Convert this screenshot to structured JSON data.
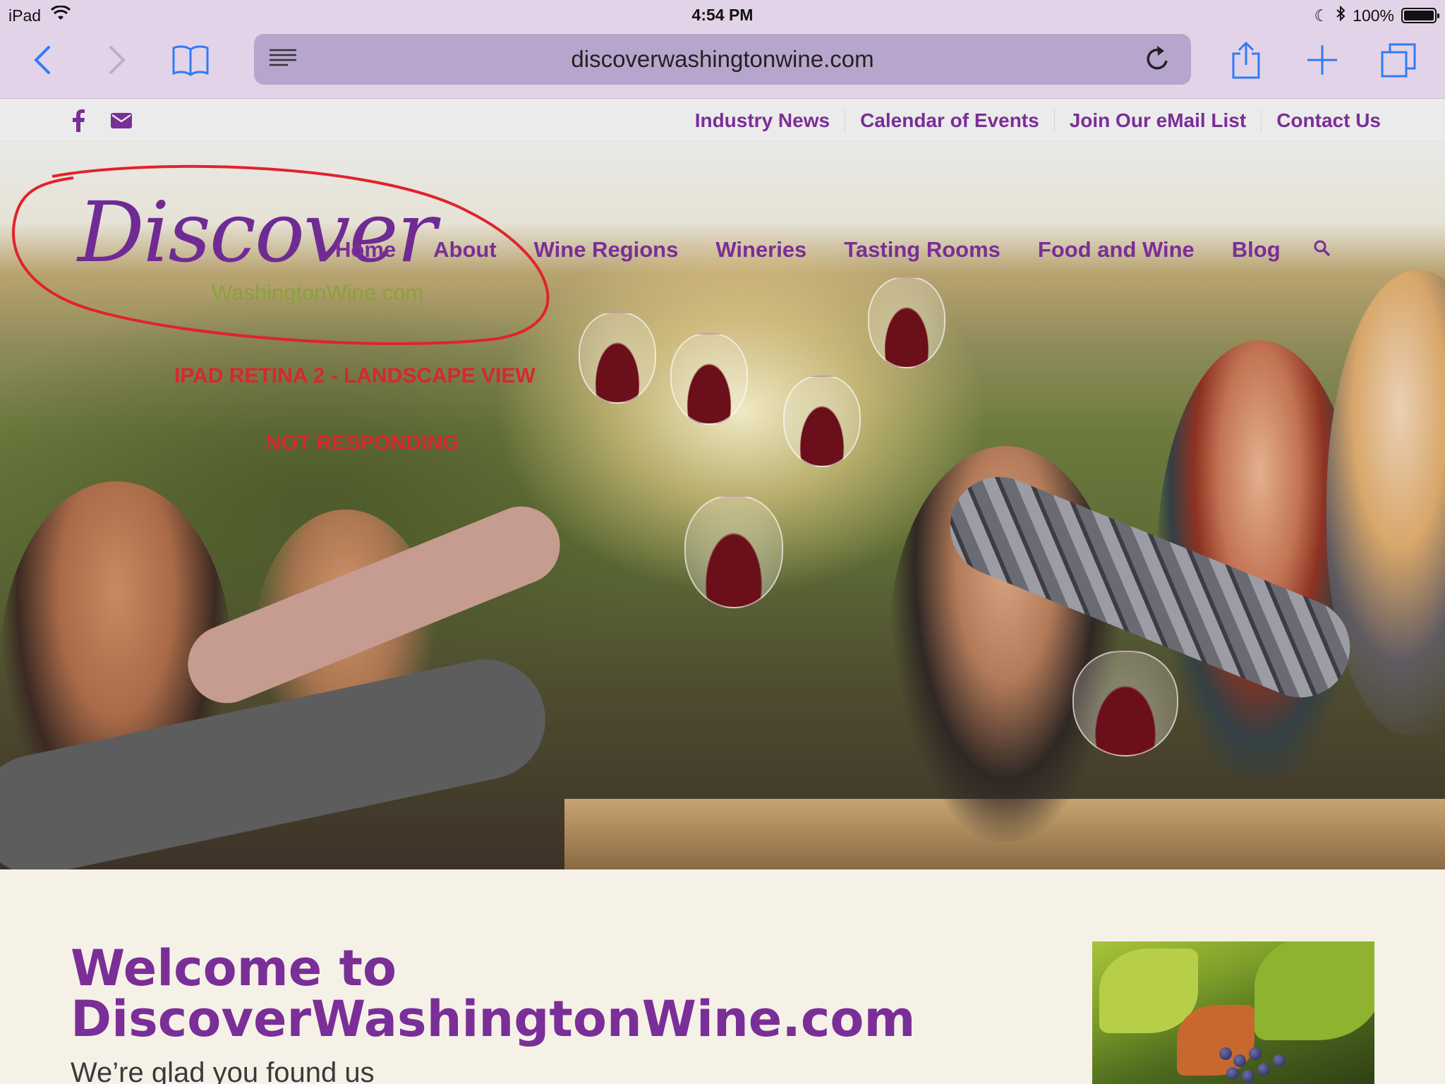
{
  "status_bar": {
    "device": "iPad",
    "time": "4:54 PM",
    "battery": "100%"
  },
  "browser": {
    "url": "discoverwashingtonwine.com"
  },
  "topbar": {
    "links": [
      "Industry News",
      "Calendar of Events",
      "Join Our eMail List",
      "Contact Us"
    ]
  },
  "logo": {
    "script_text": "Discover",
    "domain_text": "WashingtonWine.com"
  },
  "nav": {
    "items": [
      "Home",
      "About",
      "Wine Regions",
      "Wineries",
      "Tasting Rooms",
      "Food and Wine",
      "Blog"
    ]
  },
  "annotations": {
    "line1": "IPAD RETINA 2  - LANDSCAPE VIEW",
    "line2": "NOT RESPONDING",
    "color": "#d6282f"
  },
  "welcome": {
    "heading_line1": "Welcome to",
    "heading_line2": "DiscoverWashingtonWine.com",
    "tagline": "We’re glad you found us"
  },
  "colors": {
    "brand_purple": "#7a2e97",
    "brand_green": "#8aa23a",
    "browser_chrome": "#e3d3e8"
  }
}
